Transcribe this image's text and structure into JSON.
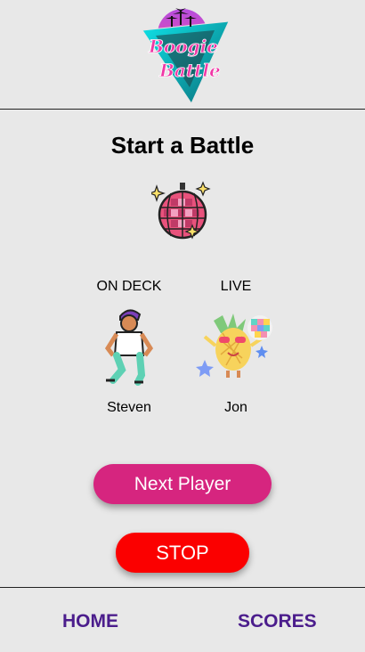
{
  "header": {
    "logo_text_line1": "Boogie",
    "logo_text_line2": "Battle"
  },
  "page": {
    "title": "Start a Battle"
  },
  "players": {
    "on_deck": {
      "status": "ON DECK",
      "name": "Steven"
    },
    "live": {
      "status": "LIVE",
      "name": "Jon"
    }
  },
  "actions": {
    "next_label": "Next Player",
    "stop_label": "STOP"
  },
  "nav": {
    "home_label": "HOME",
    "scores_label": "SCORES"
  },
  "colors": {
    "background": "#e8e8e8",
    "next_button": "#d6257f",
    "stop_button": "#fb0000",
    "nav_text": "#4b1d8c"
  },
  "icons": [
    "boogie-battle-logo",
    "disco-ball-icon",
    "breakdancer-icon",
    "dancing-pineapple-icon"
  ]
}
